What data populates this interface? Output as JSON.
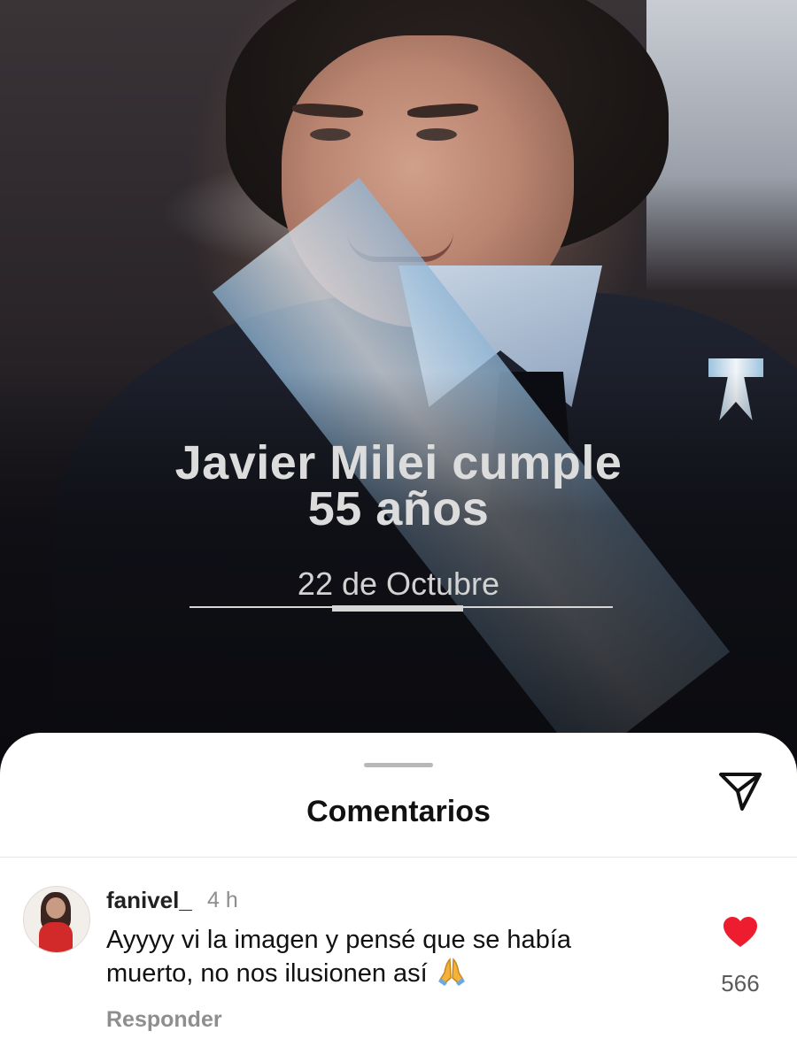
{
  "post": {
    "title_line1": "Javier Milei cumple",
    "title_line2": "55 años",
    "date": "22 de Octubre"
  },
  "comments_sheet": {
    "title": "Comentarios",
    "send_icon": "paper-plane-icon"
  },
  "comment": {
    "username": "fanivel_",
    "time": "4 h",
    "text_line1": "Ayyyy vi la imagen y pensé que se había",
    "text_line2": "muerto, no nos ilusionen así",
    "emoji_icon": "folded-hands-icon",
    "reply_label": "Responder",
    "like_icon": "heart-filled-icon",
    "like_count": "566",
    "like_color": "#ed1c2e"
  }
}
